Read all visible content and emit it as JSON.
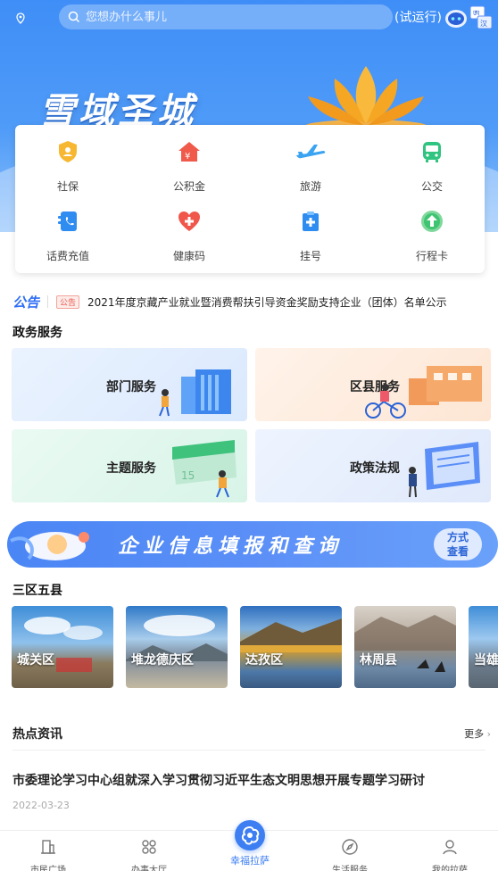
{
  "search": {
    "placeholder": "您想办什么事儿"
  },
  "header": {
    "trial_label": "(试运行)"
  },
  "hero": {
    "title": "雪域圣城"
  },
  "quick_services": [
    {
      "label": "社保",
      "icon": "social-security-shield-icon"
    },
    {
      "label": "公积金",
      "icon": "housing-fund-house-icon"
    },
    {
      "label": "旅游",
      "icon": "airplane-icon"
    },
    {
      "label": "公交",
      "icon": "bus-icon"
    },
    {
      "label": "话费充值",
      "icon": "phone-recharge-icon"
    },
    {
      "label": "健康码",
      "icon": "health-heart-icon"
    },
    {
      "label": "挂号",
      "icon": "medical-registration-icon"
    },
    {
      "label": "行程卡",
      "icon": "itinerary-arrow-icon"
    }
  ],
  "notice": {
    "brand": "公告",
    "tag": "公告",
    "text": "2021年度京藏产业就业暨消费帮扶引导资金奖励支持企业（团体）名单公示"
  },
  "gov": {
    "title": "政务服务",
    "cards": [
      {
        "label": "部门服务"
      },
      {
        "label": "区县服务"
      },
      {
        "label": "主题服务"
      },
      {
        "label": "政策法规"
      }
    ]
  },
  "banner": {
    "text": "企业信息填报和查询",
    "button": [
      "方式",
      "查看"
    ]
  },
  "counties": {
    "title": "三区五县",
    "items": [
      "城关区",
      "堆龙德庆区",
      "达孜区",
      "林周县",
      "当雄"
    ]
  },
  "news": {
    "title": "热点资讯",
    "more": "更多",
    "item_title": "市委理论学习中心组就深入学习贯彻习近平生态文明思想开展专题学习研讨",
    "item_date": "2022-03-23"
  },
  "tabbar": {
    "items": [
      "市民广场",
      "办事大厅",
      "幸福拉萨",
      "生活服务",
      "我的拉萨"
    ]
  },
  "colors": {
    "accent": "#3d7ef2",
    "notice_red": "#e85a4f"
  }
}
